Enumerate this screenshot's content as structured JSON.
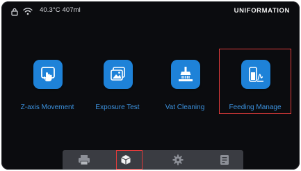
{
  "status": {
    "left_icons": [
      "lock-icon",
      "wifi-icon"
    ],
    "text": "40.3°C 407ml"
  },
  "brand": {
    "text": "UNIFORMATION"
  },
  "menu": {
    "items": [
      {
        "label": "Z-axis Movement",
        "icon": "z-axis-hand-icon"
      },
      {
        "label": "Exposure Test",
        "icon": "exposure-test-icon"
      },
      {
        "label": "Vat Cleaning",
        "icon": "vat-cleaning-icon"
      },
      {
        "label": "Feeding Manage",
        "icon": "feeding-manage-icon",
        "highlighted": true
      }
    ]
  },
  "tabbar": {
    "tabs": [
      {
        "name": "print",
        "icon": "printer-icon"
      },
      {
        "name": "tools",
        "icon": "cube-icon",
        "active": true
      },
      {
        "name": "settings",
        "icon": "gear-icon"
      },
      {
        "name": "files",
        "icon": "file-icon"
      }
    ]
  },
  "colors": {
    "background": "#0b0c0f",
    "accent": "#1e82d8",
    "label": "#3c93e0",
    "highlight": "#e13b3b",
    "tabbar": "#3a3c42"
  }
}
